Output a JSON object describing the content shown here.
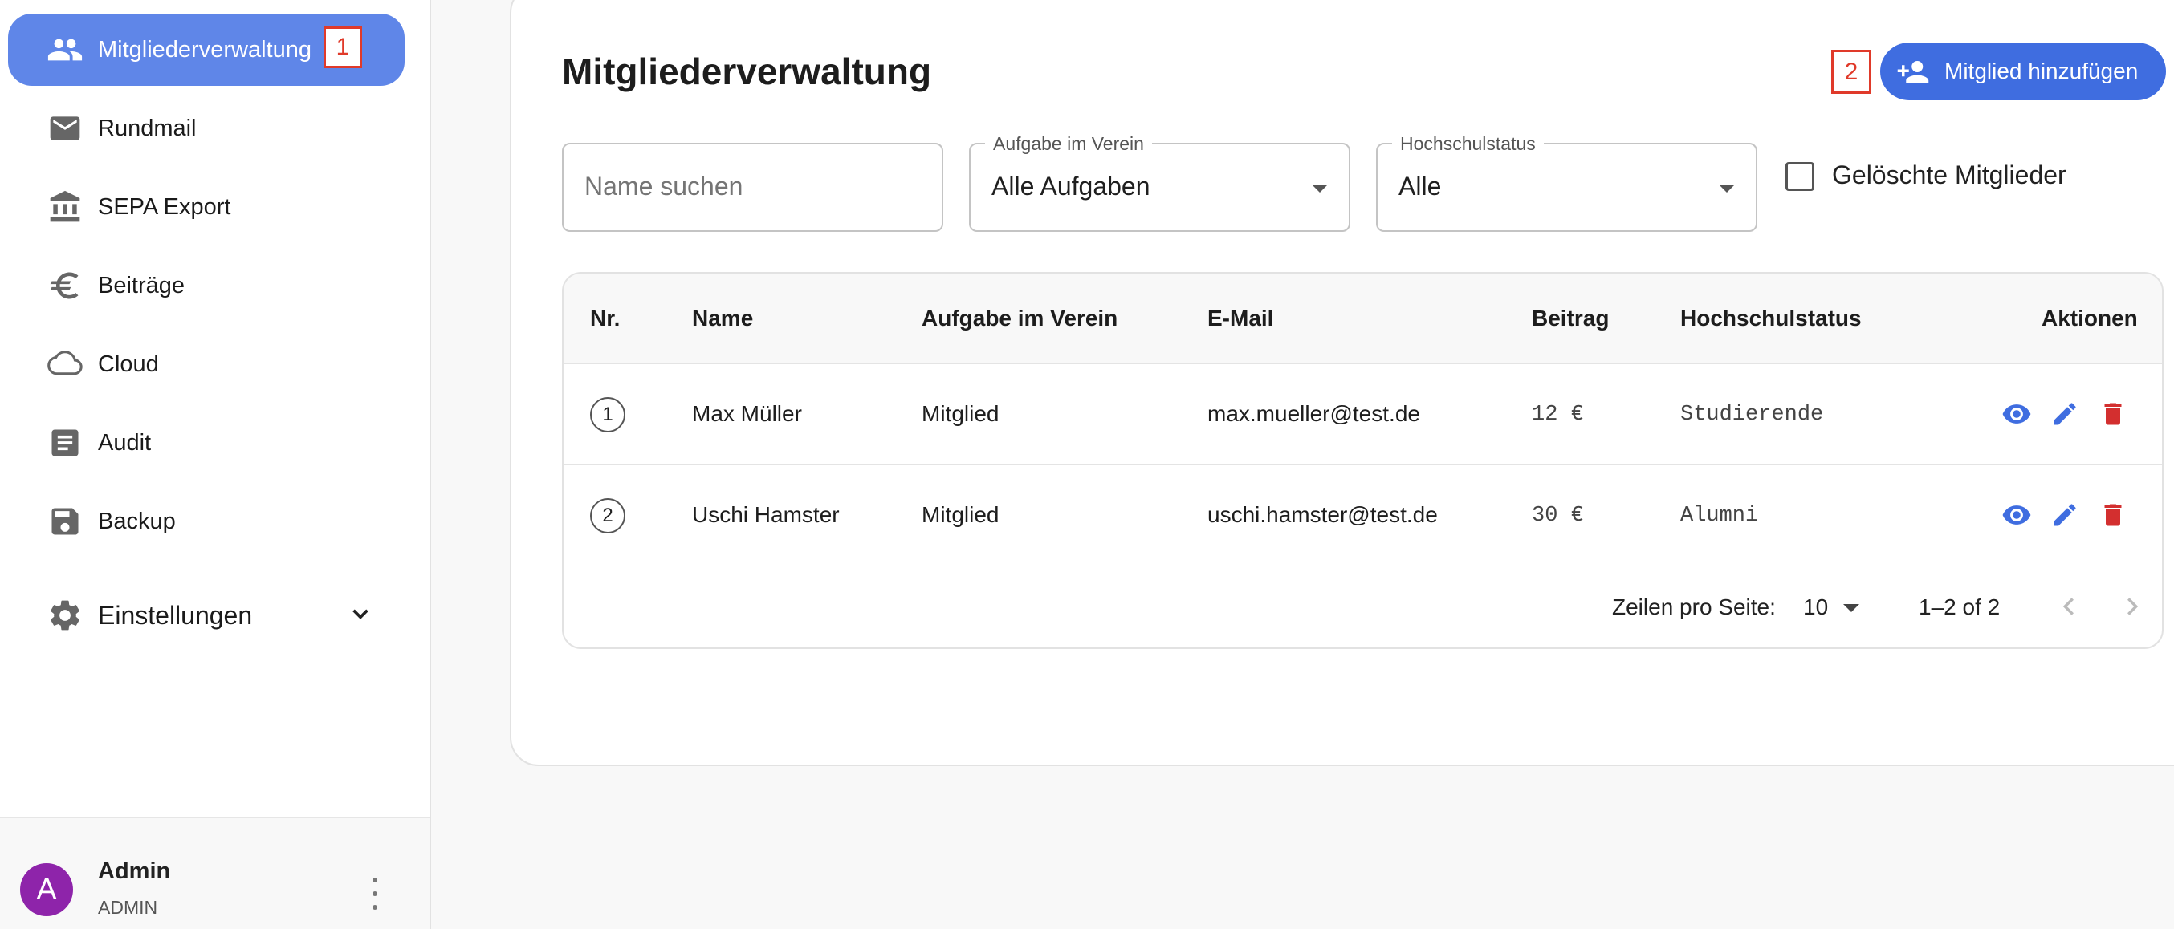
{
  "sidebar": {
    "items": [
      {
        "label": "Mitgliederverwaltung",
        "icon": "people-icon",
        "active": true
      },
      {
        "label": "Rundmail",
        "icon": "mail-icon"
      },
      {
        "label": "SEPA Export",
        "icon": "bank-icon"
      },
      {
        "label": "Beiträge",
        "icon": "euro-icon"
      },
      {
        "label": "Cloud",
        "icon": "cloud-icon"
      },
      {
        "label": "Audit",
        "icon": "document-icon"
      },
      {
        "label": "Backup",
        "icon": "save-icon"
      }
    ],
    "settings": {
      "label": "Einstellungen",
      "icon": "gear-icon"
    },
    "tag1": "1"
  },
  "user": {
    "initial": "A",
    "name": "Admin",
    "role": "ADMIN"
  },
  "main": {
    "title": "Mitgliederverwaltung",
    "tag2": "2",
    "add_button": "Mitglied hinzufügen",
    "search": {
      "placeholder": "Name suchen"
    },
    "role_filter": {
      "label": "Aufgabe im Verein",
      "value": "Alle Aufgaben"
    },
    "status_filter": {
      "label": "Hochschulstatus",
      "value": "Alle"
    },
    "deleted_checkbox": {
      "label": "Gelöschte Mitglieder",
      "checked": false
    }
  },
  "table": {
    "headers": [
      "Nr.",
      "Name",
      "Aufgabe im Verein",
      "E-Mail",
      "Beitrag",
      "Hochschulstatus",
      "Aktionen"
    ],
    "rows": [
      {
        "nr": "1",
        "name": "Max Müller",
        "role": "Mitglied",
        "email": "max.mueller@test.de",
        "fee": "12 €",
        "status": "Studierende"
      },
      {
        "nr": "2",
        "name": "Uschi Hamster",
        "role": "Mitglied",
        "email": "uschi.hamster@test.de",
        "fee": "30 €",
        "status": "Alumni"
      }
    ],
    "pagination": {
      "rows_label": "Zeilen pro Seite:",
      "rows_value": "10",
      "range": "1–2 of 2"
    }
  },
  "colors": {
    "accent": "#3f6de0",
    "active_nav": "#5f86e8",
    "delete": "#d32f2f",
    "avatar": "#8e24aa",
    "tag": "#e03a2a"
  }
}
